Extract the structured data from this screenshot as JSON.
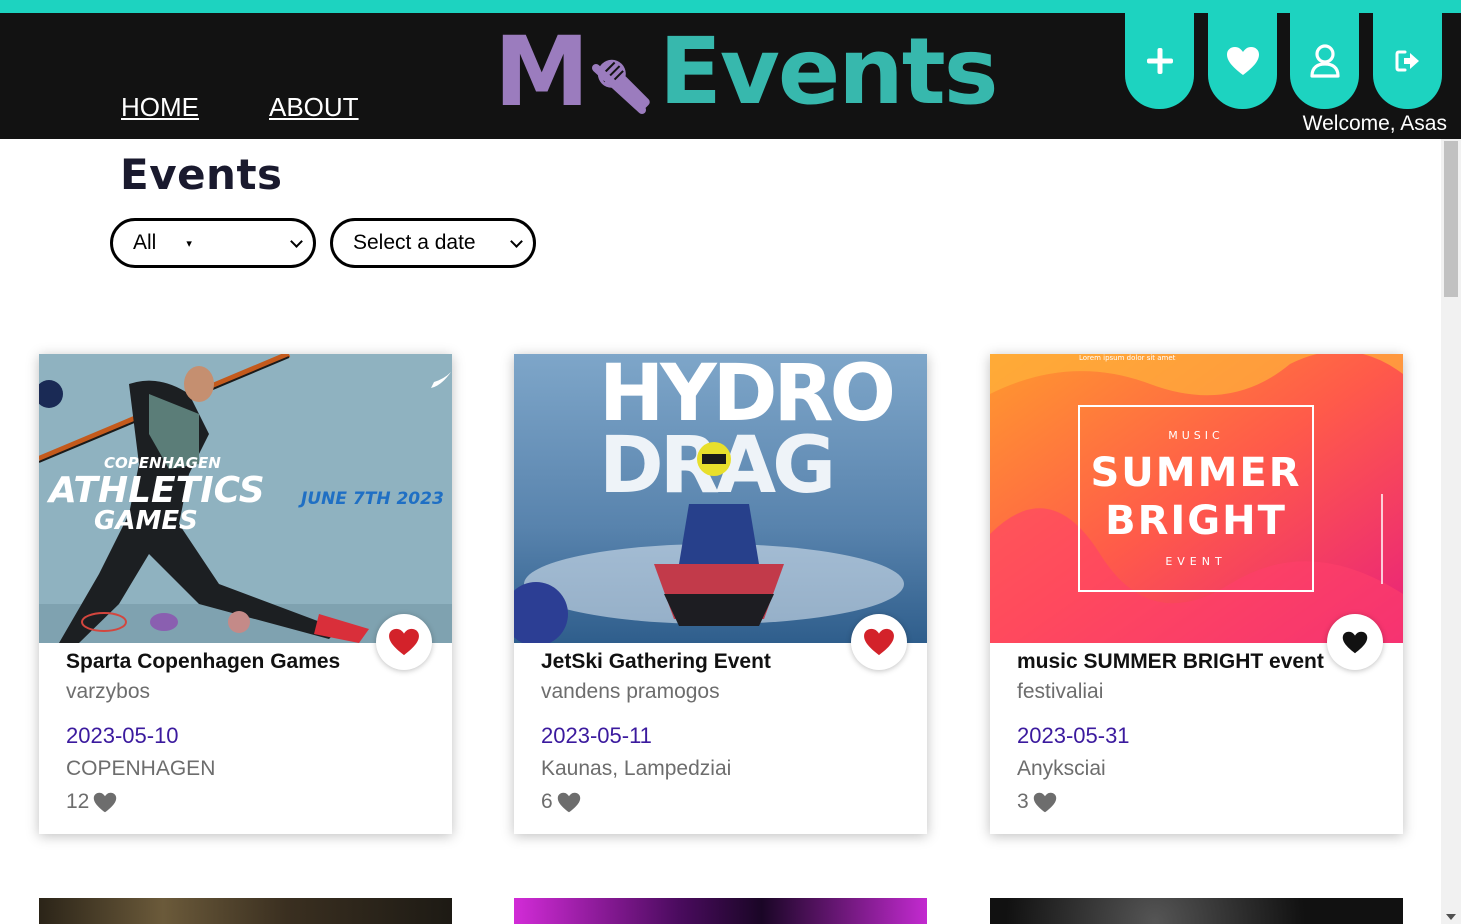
{
  "header": {
    "nav": [
      {
        "label": "HOME"
      },
      {
        "label": "ABOUT"
      }
    ],
    "logo": {
      "part1": "M",
      "part2": "Events"
    },
    "actions": [
      {
        "icon": "plus-icon"
      },
      {
        "icon": "heart-icon"
      },
      {
        "icon": "user-icon"
      },
      {
        "icon": "logout-icon"
      }
    ],
    "welcome": "Welcome, Asas",
    "accent_color": "#1dd3c0"
  },
  "main": {
    "title": "Events",
    "filters": {
      "category": {
        "selected": "All",
        "marker": "▾"
      },
      "date": {
        "selected": "Select a date"
      }
    },
    "events": [
      {
        "title": "Sparta Copenhagen Games",
        "category": "varzybos",
        "date": "2023-05-10",
        "location": "COPENHAGEN",
        "likes": "12",
        "favorited": true,
        "poster": {
          "line1": "COPENHAGEN",
          "line2": "ATHLETICS",
          "line3": "GAMES",
          "line4": "JUNE 7TH 2023"
        }
      },
      {
        "title": "JetSki Gathering Event",
        "category": "vandens pramogos",
        "date": "2023-05-11",
        "location": "Kaunas, Lampedziai",
        "likes": "6",
        "favorited": true,
        "poster": {
          "line1": "HYDRO",
          "line2": "DRAG"
        }
      },
      {
        "title": "music SUMMER BRIGHT event",
        "category": "festivaliai",
        "date": "2023-05-31",
        "location": "Anyksciai",
        "likes": "3",
        "favorited": false,
        "poster": {
          "line0": "Lorem ipsum dolor sit amet",
          "line1": "MUSIC",
          "line2": "SUMMER",
          "line3": "BRIGHT",
          "line4": "EVENT"
        }
      }
    ]
  }
}
